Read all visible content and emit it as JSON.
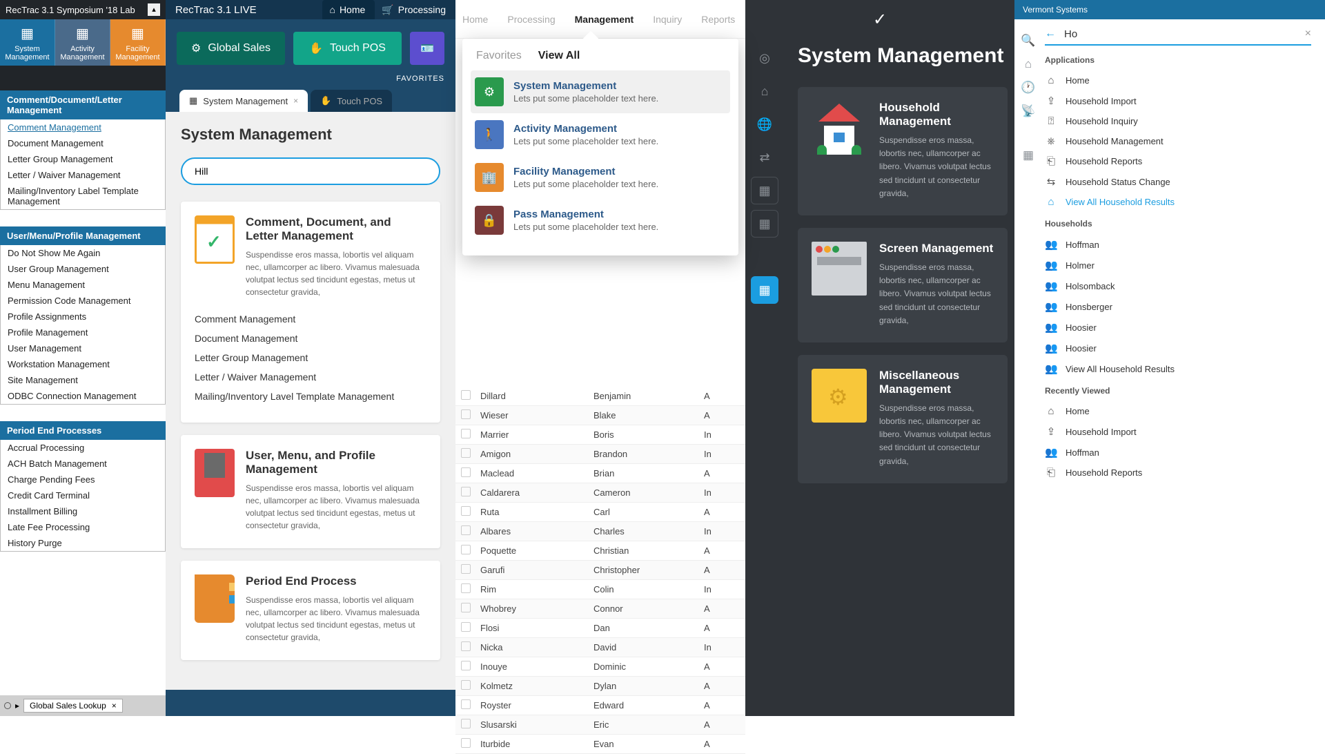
{
  "panel1": {
    "header": "RecTrac 3.1 Symposium '18 Lab",
    "tiles": [
      {
        "label": "System Management"
      },
      {
        "label": "Activity Management"
      },
      {
        "label": "Facility Management"
      }
    ],
    "sections": [
      {
        "title": "Comment/Document/Letter Management",
        "items": [
          "Comment Management",
          "Document Management",
          "Letter Group Management",
          "Letter / Waiver Management",
          "Mailing/Inventory Label Template Management"
        ],
        "selected": 0
      },
      {
        "title": "User/Menu/Profile Management",
        "items": [
          "Do Not Show Me Again",
          "User Group Management",
          "Menu Management",
          "Permission Code Management",
          "Profile Assignments",
          "Profile Management",
          "User Management",
          "Workstation Management",
          "Site Management",
          "ODBC Connection Management"
        ]
      },
      {
        "title": "Period End Processes",
        "items": [
          "Accrual Processing",
          "ACH Batch Management",
          "Charge Pending Fees",
          "Credit Card Terminal",
          "Installment Billing",
          "Late Fee Processing",
          "History Purge"
        ]
      }
    ],
    "footer_chip": "Global Sales Lookup"
  },
  "panel2": {
    "brand": "RecTrac 3.1",
    "live": "LIVE",
    "nav": [
      {
        "label": "Home",
        "glyph": "⌂"
      },
      {
        "label": "Processing",
        "glyph": "🛒"
      }
    ],
    "buttons": {
      "global_sales": "Global Sales",
      "touch_pos": "Touch POS"
    },
    "favorites": "FAVORITES",
    "tabs": [
      {
        "label": "System Management",
        "active": true
      },
      {
        "label": "Touch POS",
        "active": false
      }
    ],
    "heading": "System Management",
    "search_value": "Hill",
    "cards": [
      {
        "title": "Comment, Document, and Letter Management",
        "desc": "Suspendisse eros massa, lobortis vel aliquam nec, ullamcorper ac libero. Vivamus malesuada volutpat lectus sed tincidunt egestas, metus ut consectetur gravida,",
        "icon": "clip",
        "links": [
          "Comment Management",
          "Document Management",
          "Letter Group Management",
          "Letter / Waiver Management",
          "Mailing/Inventory Lavel Template Management"
        ]
      },
      {
        "title": "User, Menu, and Profile Management",
        "desc": "Suspendisse eros massa, lobortis vel aliquam nec, ullamcorper ac libero. Vivamus malesuada volutpat lectus sed tincidunt egestas, metus ut consectetur gravida,",
        "icon": "mon",
        "links": []
      },
      {
        "title": "Period End Process",
        "desc": "Suspendisse eros massa, lobortis vel aliquam nec, ullamcorper ac libero. Vivamus malesuada volutpat lectus sed tincidunt egestas, metus ut consectetur gravida,",
        "icon": "fold",
        "links": []
      }
    ]
  },
  "panel3": {
    "nav": [
      "Home",
      "Processing",
      "Management",
      "Inquiry",
      "Reports"
    ],
    "nav_active": 2,
    "dd_tabs": [
      "Favorites",
      "View All"
    ],
    "dd_active": 1,
    "dd_items": [
      {
        "title": "System Management",
        "sub": "Lets put some placeholder text here.",
        "icon": "sys"
      },
      {
        "title": "Activity Management",
        "sub": "Lets put some placeholder text here.",
        "icon": "act"
      },
      {
        "title": "Facility Management",
        "sub": "Lets put some placeholder text here.",
        "icon": "fac"
      },
      {
        "title": "Pass Management",
        "sub": "Lets put some placeholder text here.",
        "icon": "pass"
      }
    ],
    "table": [
      {
        "last": "Dillard",
        "first": "Benjamin",
        "c3": "A"
      },
      {
        "last": "Wieser",
        "first": "Blake",
        "c3": "A"
      },
      {
        "last": "Marrier",
        "first": "Boris",
        "c3": "In"
      },
      {
        "last": "Amigon",
        "first": "Brandon",
        "c3": "In"
      },
      {
        "last": "Maclead",
        "first": "Brian",
        "c3": "A"
      },
      {
        "last": "Caldarera",
        "first": "Cameron",
        "c3": "In"
      },
      {
        "last": "Ruta",
        "first": "Carl",
        "c3": "A"
      },
      {
        "last": "Albares",
        "first": "Charles",
        "c3": "In"
      },
      {
        "last": "Poquette",
        "first": "Christian",
        "c3": "A"
      },
      {
        "last": "Garufi",
        "first": "Christopher",
        "c3": "A"
      },
      {
        "last": "Rim",
        "first": "Colin",
        "c3": "In"
      },
      {
        "last": "Whobrey",
        "first": "Connor",
        "c3": "A"
      },
      {
        "last": "Flosi",
        "first": "Dan",
        "c3": "A"
      },
      {
        "last": "Nicka",
        "first": "David",
        "c3": "In"
      },
      {
        "last": "Inouye",
        "first": "Dominic",
        "c3": "A"
      },
      {
        "last": "Kolmetz",
        "first": "Dylan",
        "c3": "A"
      },
      {
        "last": "Royster",
        "first": "Edward",
        "c3": "A"
      },
      {
        "last": "Slusarski",
        "first": "Eric",
        "c3": "A"
      },
      {
        "last": "Iturbide",
        "first": "Evan",
        "c3": "A"
      }
    ]
  },
  "panel4": {
    "heading": "System Management",
    "cards": [
      {
        "title": "Household Management",
        "icon": "house",
        "desc": "Suspendisse eros massa, lobortis nec, ullamcorper ac libero. Vivamus volutpat lectus sed tincidunt ut consectetur gravida,"
      },
      {
        "title": "Screen Management",
        "icon": "scrn",
        "desc": "Suspendisse eros massa, lobortis nec, ullamcorper ac libero. Vivamus volutpat lectus sed tincidunt ut consectetur gravida,"
      },
      {
        "title": "Miscellaneous Management",
        "icon": "fldr",
        "desc": "Suspendisse eros massa, lobortis nec, ullamcorper ac libero. Vivamus volutpat lectus sed tincidunt ut consectetur gravida,"
      }
    ]
  },
  "panel5": {
    "logo": "Vermont Systems",
    "query": "Ho",
    "groups": [
      {
        "label": "Applications",
        "items": [
          {
            "icon": "⌂",
            "label": "Home"
          },
          {
            "icon": "⇪",
            "label": "Household Import"
          },
          {
            "icon": "⍰",
            "label": "Household Inquiry"
          },
          {
            "icon": "⎈",
            "label": "Household Management"
          },
          {
            "icon": "⎗",
            "label": "Household Reports"
          },
          {
            "icon": "⇆",
            "label": "Household Status Change"
          },
          {
            "icon": "⌂",
            "label": "View All Household Results",
            "viewall": true
          }
        ]
      },
      {
        "label": "Households",
        "items": [
          {
            "icon": "👥",
            "label": "Hoffman"
          },
          {
            "icon": "👥",
            "label": "Holmer"
          },
          {
            "icon": "👥",
            "label": "Holsomback"
          },
          {
            "icon": "👥",
            "label": "Honsberger"
          },
          {
            "icon": "👥",
            "label": "Hoosier"
          },
          {
            "icon": "👥",
            "label": "Hoosier"
          },
          {
            "icon": "👥",
            "label": "View All Household Results"
          }
        ]
      },
      {
        "label": "Recently Viewed",
        "items": [
          {
            "icon": "⌂",
            "label": "Home"
          },
          {
            "icon": "⇪",
            "label": "Household Import"
          },
          {
            "icon": "👥",
            "label": "Hoffman"
          },
          {
            "icon": "⎗",
            "label": "Household Reports"
          }
        ]
      }
    ]
  }
}
